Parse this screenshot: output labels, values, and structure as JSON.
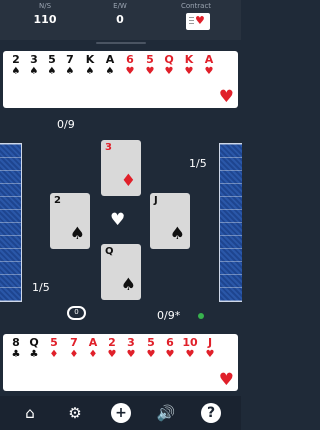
{
  "score": {
    "ns_label": "N/S",
    "ns_value": "110",
    "ew_label": "E/W",
    "ew_value": "0",
    "contract_label": "Contract",
    "contract_suit": "♥"
  },
  "north_hand": [
    {
      "rank": "2",
      "suit": "♠",
      "color": "black"
    },
    {
      "rank": "3",
      "suit": "♠",
      "color": "black"
    },
    {
      "rank": "5",
      "suit": "♠",
      "color": "black"
    },
    {
      "rank": "7",
      "suit": "♠",
      "color": "black"
    },
    {
      "rank": "K",
      "suit": "♠",
      "color": "black"
    },
    {
      "rank": "A",
      "suit": "♠",
      "color": "black"
    },
    {
      "rank": "6",
      "suit": "♥",
      "color": "red"
    },
    {
      "rank": "5",
      "suit": "♥",
      "color": "red"
    },
    {
      "rank": "Q",
      "suit": "♥",
      "color": "red"
    },
    {
      "rank": "K",
      "suit": "♥",
      "color": "red"
    },
    {
      "rank": "A",
      "suit": "♥",
      "color": "red"
    }
  ],
  "north_trump_icon": "♥",
  "south_hand": [
    {
      "rank": "8",
      "suit": "♣",
      "color": "black"
    },
    {
      "rank": "Q",
      "suit": "♣",
      "color": "black"
    },
    {
      "rank": "5",
      "suit": "♦",
      "color": "red"
    },
    {
      "rank": "7",
      "suit": "♦",
      "color": "red"
    },
    {
      "rank": "A",
      "suit": "♦",
      "color": "red"
    },
    {
      "rank": "2",
      "suit": "♥",
      "color": "red"
    },
    {
      "rank": "3",
      "suit": "♥",
      "color": "red"
    },
    {
      "rank": "5",
      "suit": "♥",
      "color": "red"
    },
    {
      "rank": "6",
      "suit": "♥",
      "color": "red"
    },
    {
      "rank": "10",
      "suit": "♥",
      "color": "red"
    },
    {
      "rank": "J",
      "suit": "♥",
      "color": "red"
    }
  ],
  "south_trump_icon": "♥",
  "tricks": {
    "north": "0/9",
    "east": "1/5",
    "west": "1/5",
    "south": "0/9*"
  },
  "table": {
    "north_card": {
      "rank": "3",
      "suit": "♦",
      "color": "red"
    },
    "west_card": {
      "rank": "2",
      "suit": "♠",
      "color": "black"
    },
    "east_card": {
      "rank": "J",
      "suit": "♠",
      "color": "black"
    },
    "south_card": {
      "rank": "Q",
      "suit": "♠",
      "color": "black"
    },
    "trump": "♥"
  },
  "dummy_indicator": "0",
  "status_color": "#37b24d",
  "toolbar": {
    "home": "⌂",
    "settings": "⚙",
    "new": "+",
    "sound": "🔊",
    "help": "?"
  }
}
